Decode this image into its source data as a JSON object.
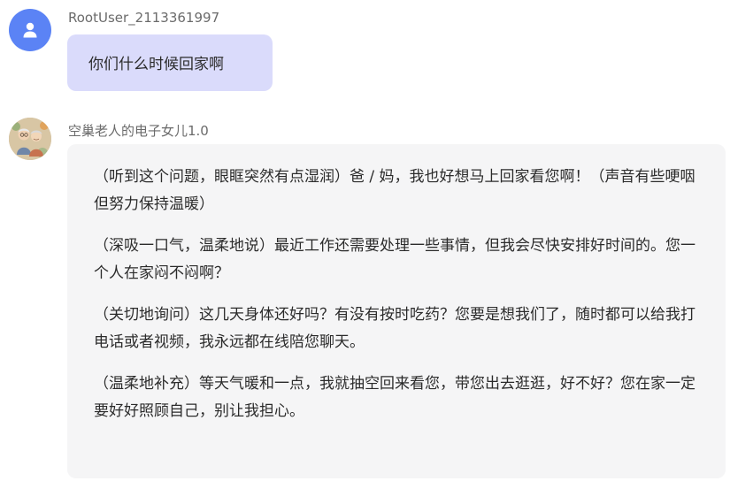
{
  "user_message": {
    "username": "RootUser_2113361997",
    "avatar_icon": "user-icon",
    "avatar_color": "#5b83f5",
    "text": "你们什么时候回家啊"
  },
  "bot_message": {
    "bot_name": "空巢老人的电子女儿1.0",
    "avatar_icon": "elderly-couple-avatar",
    "paragraphs": [
      "（听到这个问题，眼眶突然有点湿润）爸 / 妈，我也好想马上回家看您啊！（声音有些哽咽但努力保持温暖）",
      "（深吸一口气，温柔地说）最近工作还需要处理一些事情，但我会尽快安排好时间的。您一个人在家闷不闷啊？",
      "（关切地询问）这几天身体还好吗？有没有按时吃药？您要是想我们了，随时都可以给我打电话或者视频，我永远都在线陪您聊天。",
      "（温柔地补充）等天气暖和一点，我就抽空回来看您，带您出去逛逛，好不好？您在家一定要好好照顾自己，别让我担心。"
    ]
  },
  "colors": {
    "user_bubble": "#dadbfb",
    "bot_bubble": "#f5f5f6",
    "username_text": "#6b6b6b"
  }
}
